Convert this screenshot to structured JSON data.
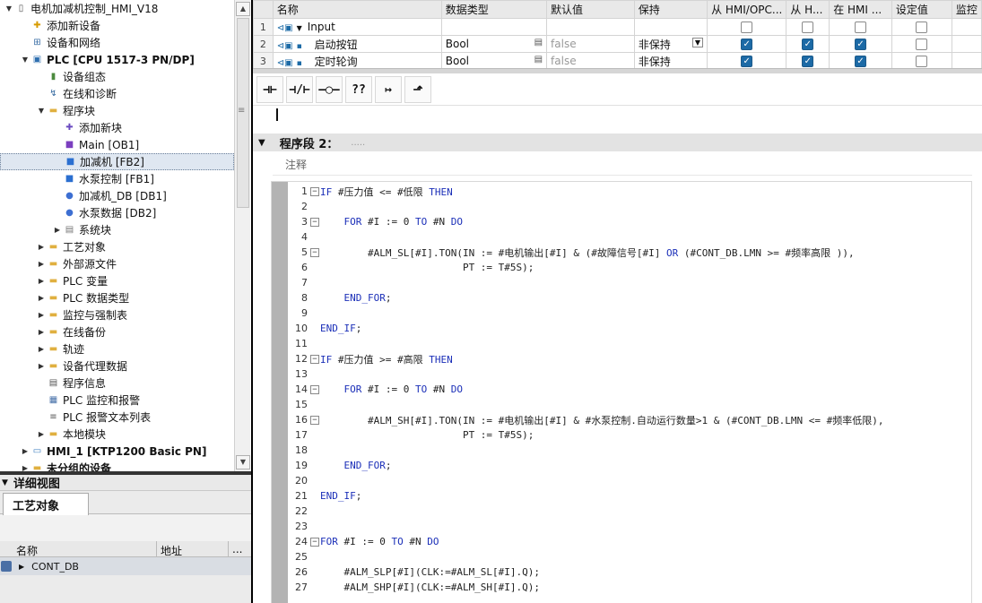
{
  "tree": {
    "items": [
      {
        "label": "电机加减机控制_HMI_V18",
        "arrow": "▼",
        "icon": "project-icon",
        "indent": 0,
        "bold": false
      },
      {
        "label": "添加新设备",
        "arrow": "",
        "icon": "add-device-icon",
        "indent": 1,
        "bold": false
      },
      {
        "label": "设备和网络",
        "arrow": "",
        "icon": "network-icon",
        "indent": 1,
        "bold": false
      },
      {
        "label": "PLC [CPU 1517-3 PN/DP]",
        "arrow": "▼",
        "icon": "plc-icon",
        "indent": 1,
        "bold": true
      },
      {
        "label": "设备组态",
        "arrow": "",
        "icon": "device-config-icon",
        "indent": 2,
        "bold": false
      },
      {
        "label": "在线和诊断",
        "arrow": "",
        "icon": "diagnostics-icon",
        "indent": 2,
        "bold": false
      },
      {
        "label": "程序块",
        "arrow": "▼",
        "icon": "folder-icon",
        "indent": 2,
        "bold": false
      },
      {
        "label": "添加新块",
        "arrow": "",
        "icon": "add-block-icon",
        "indent": 3,
        "bold": false
      },
      {
        "label": "Main [OB1]",
        "arrow": "",
        "icon": "ob-icon",
        "indent": 3,
        "bold": false
      },
      {
        "label": "加减机 [FB2]",
        "arrow": "",
        "icon": "fb-icon",
        "indent": 3,
        "bold": false,
        "selected": true
      },
      {
        "label": "水泵控制 [FB1]",
        "arrow": "",
        "icon": "fb-icon",
        "indent": 3,
        "bold": false
      },
      {
        "label": "加减机_DB [DB1]",
        "arrow": "",
        "icon": "db-icon",
        "indent": 3,
        "bold": false
      },
      {
        "label": "水泵数据 [DB2]",
        "arrow": "",
        "icon": "db-icon",
        "indent": 3,
        "bold": false
      },
      {
        "label": "系统块",
        "arrow": "▶",
        "icon": "system-block-icon",
        "indent": 3,
        "bold": false
      },
      {
        "label": "工艺对象",
        "arrow": "▶",
        "icon": "folder-icon",
        "indent": 2,
        "bold": false
      },
      {
        "label": "外部源文件",
        "arrow": "▶",
        "icon": "folder-icon",
        "indent": 2,
        "bold": false
      },
      {
        "label": "PLC 变量",
        "arrow": "▶",
        "icon": "folder-icon",
        "indent": 2,
        "bold": false
      },
      {
        "label": "PLC 数据类型",
        "arrow": "▶",
        "icon": "folder-icon",
        "indent": 2,
        "bold": false
      },
      {
        "label": "监控与强制表",
        "arrow": "▶",
        "icon": "folder-icon",
        "indent": 2,
        "bold": false
      },
      {
        "label": "在线备份",
        "arrow": "▶",
        "icon": "folder-icon",
        "indent": 2,
        "bold": false
      },
      {
        "label": "轨迹",
        "arrow": "▶",
        "icon": "folder-icon",
        "indent": 2,
        "bold": false
      },
      {
        "label": "设备代理数据",
        "arrow": "▶",
        "icon": "folder-icon",
        "indent": 2,
        "bold": false
      },
      {
        "label": "程序信息",
        "arrow": "",
        "icon": "program-info-icon",
        "indent": 2,
        "bold": false
      },
      {
        "label": "PLC 监控和报警",
        "arrow": "",
        "icon": "alarm-icon",
        "indent": 2,
        "bold": false
      },
      {
        "label": "PLC 报警文本列表",
        "arrow": "",
        "icon": "text-list-icon",
        "indent": 2,
        "bold": false
      },
      {
        "label": "本地模块",
        "arrow": "▶",
        "icon": "folder-icon",
        "indent": 2,
        "bold": false
      },
      {
        "label": "HMI_1 [KTP1200 Basic PN]",
        "arrow": "▶",
        "icon": "hmi-icon",
        "indent": 1,
        "bold": true
      },
      {
        "label": "未分组的设备",
        "arrow": "▶",
        "icon": "folder-icon",
        "indent": 1,
        "bold": true
      }
    ]
  },
  "detail": {
    "title": "详细视图",
    "tab": "工艺对象",
    "col_name": "名称",
    "col_address": "地址",
    "col_more": "...",
    "row_label": "CONT_DB"
  },
  "interface": {
    "headers": [
      "",
      "名称",
      "数据类型",
      "默认值",
      "保持",
      "从 HMI/OPC...",
      "从 H...",
      "在 HMI ...",
      "设定值",
      "监控"
    ],
    "rows": [
      {
        "num": "1",
        "name": "Input",
        "type": "",
        "default": "",
        "retain": "",
        "c1": false,
        "c2": false,
        "c3": false,
        "c4": false,
        "section": true
      },
      {
        "num": "2",
        "name": "启动按钮",
        "type": "Bool",
        "default": "false",
        "retain": "非保持",
        "c1": true,
        "c2": true,
        "c3": true,
        "c4": false
      },
      {
        "num": "3",
        "name": "定时轮询",
        "type": "Bool",
        "default": "false",
        "retain": "非保持",
        "c1": true,
        "c2": true,
        "c3": true,
        "c4": false
      }
    ]
  },
  "toolbar": {
    "buttons": [
      "⊣⊢",
      "⊣/⊢",
      "–◯–",
      "??",
      "↦",
      "⬏"
    ]
  },
  "segment": {
    "title": "程序段 2：",
    "dots": ".....",
    "comment": "注释"
  },
  "code": {
    "lines": [
      {
        "n": "1",
        "fold": "−",
        "text": "IF #压力值 <= #低限 THEN"
      },
      {
        "n": "2",
        "fold": "",
        "text": ""
      },
      {
        "n": "3",
        "fold": "−",
        "text": "    FOR #I := 0 TO #N DO"
      },
      {
        "n": "4",
        "fold": "",
        "text": ""
      },
      {
        "n": "5",
        "fold": "−",
        "text": "        #ALM_SL[#I].TON(IN := #电机输出[#I] & (#故障信号[#I] OR (#CONT_DB.LMN >= #频率高限 )),"
      },
      {
        "n": "6",
        "fold": "",
        "text": "                        PT := T#5S);"
      },
      {
        "n": "7",
        "fold": "",
        "text": ""
      },
      {
        "n": "8",
        "fold": "",
        "text": "    END_FOR;"
      },
      {
        "n": "9",
        "fold": "",
        "text": ""
      },
      {
        "n": "10",
        "fold": "",
        "text": "END_IF;"
      },
      {
        "n": "11",
        "fold": "",
        "text": ""
      },
      {
        "n": "12",
        "fold": "−",
        "text": "IF #压力值 >= #高限 THEN"
      },
      {
        "n": "13",
        "fold": "",
        "text": ""
      },
      {
        "n": "14",
        "fold": "−",
        "text": "    FOR #I := 0 TO #N DO"
      },
      {
        "n": "15",
        "fold": "",
        "text": ""
      },
      {
        "n": "16",
        "fold": "−",
        "text": "        #ALM_SH[#I].TON(IN := #电机输出[#I] & #水泵控制.自动运行数量>1 & (#CONT_DB.LMN <= #频率低限),"
      },
      {
        "n": "17",
        "fold": "",
        "text": "                        PT := T#5S);"
      },
      {
        "n": "18",
        "fold": "",
        "text": ""
      },
      {
        "n": "19",
        "fold": "",
        "text": "    END_FOR;"
      },
      {
        "n": "20",
        "fold": "",
        "text": ""
      },
      {
        "n": "21",
        "fold": "",
        "text": "END_IF;"
      },
      {
        "n": "22",
        "fold": "",
        "text": ""
      },
      {
        "n": "23",
        "fold": "",
        "text": ""
      },
      {
        "n": "24",
        "fold": "−",
        "text": "FOR #I := 0 TO #N DO"
      },
      {
        "n": "25",
        "fold": "",
        "text": ""
      },
      {
        "n": "26",
        "fold": "",
        "text": "    #ALM_SLP[#I](CLK:=#ALM_SL[#I].Q);"
      },
      {
        "n": "27",
        "fold": "",
        "text": "    #ALM_SHP[#I](CLK:=#ALM_SH[#I].Q);"
      }
    ]
  },
  "colors": {
    "keyword": "#1b2fb8",
    "selected_row": "#dfe7f1",
    "checkbox": "#1c6aa6",
    "gutter": "#b3b3b3"
  }
}
